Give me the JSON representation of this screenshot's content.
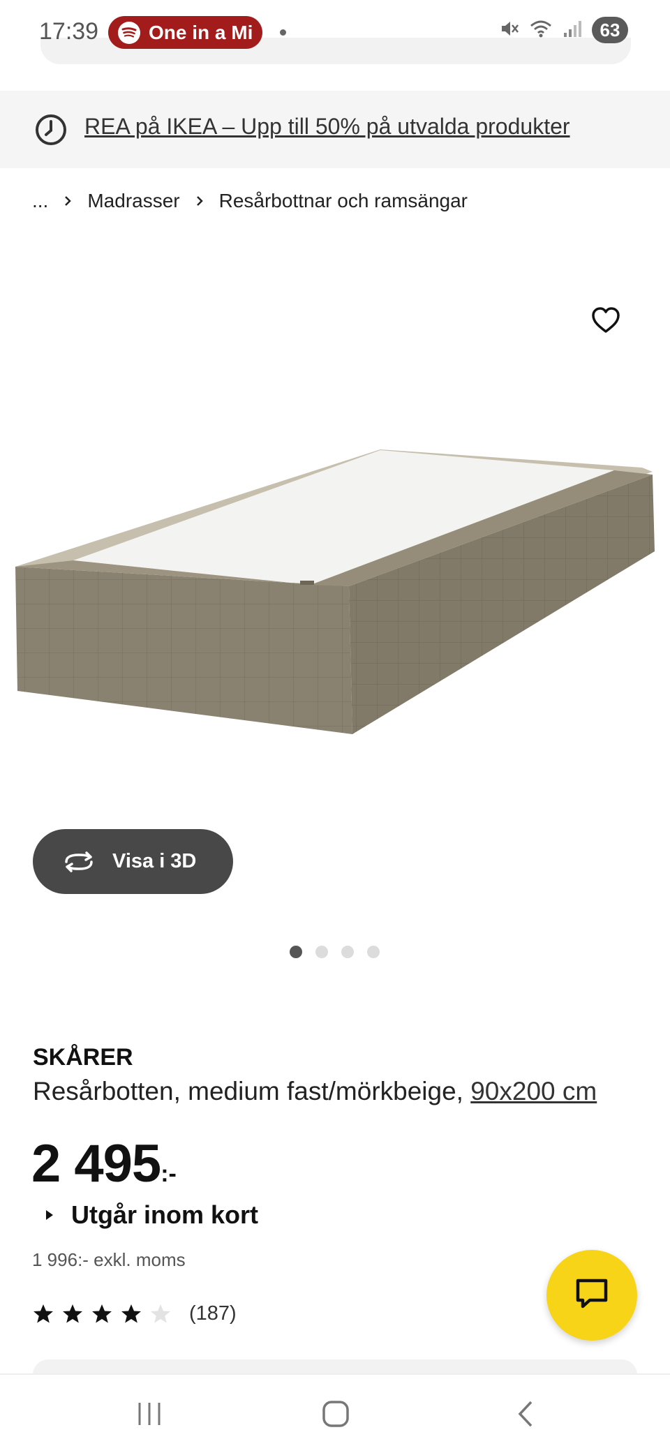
{
  "status_bar": {
    "time": "17:39",
    "media_label": "One in a Mi",
    "battery": "63"
  },
  "promo": {
    "text": "REA på IKEA – Upp till 50% på utvalda produkter"
  },
  "breadcrumb": {
    "items": [
      "...",
      "Madrasser",
      "Resårbottnar och ramsängar"
    ]
  },
  "gallery": {
    "view_3d_label": "Visa i 3D",
    "image_count": 4,
    "active_index": 0
  },
  "product": {
    "name": "SKÅRER",
    "description": "Resårbotten, medium fast/mörkbeige,",
    "size_link": "90x200 cm",
    "price": "2 495",
    "price_suffix": ":-",
    "availability": "Utgår inom kort",
    "price_excl_vat": "1 996:- exkl. moms",
    "rating": 4,
    "rating_max": 5,
    "review_count": "(187)"
  },
  "colors": {
    "accent_yellow": "#f8d419",
    "media_red": "#a31c1c",
    "button_dark": "#484848",
    "mattress_beige": "#8a8270"
  }
}
